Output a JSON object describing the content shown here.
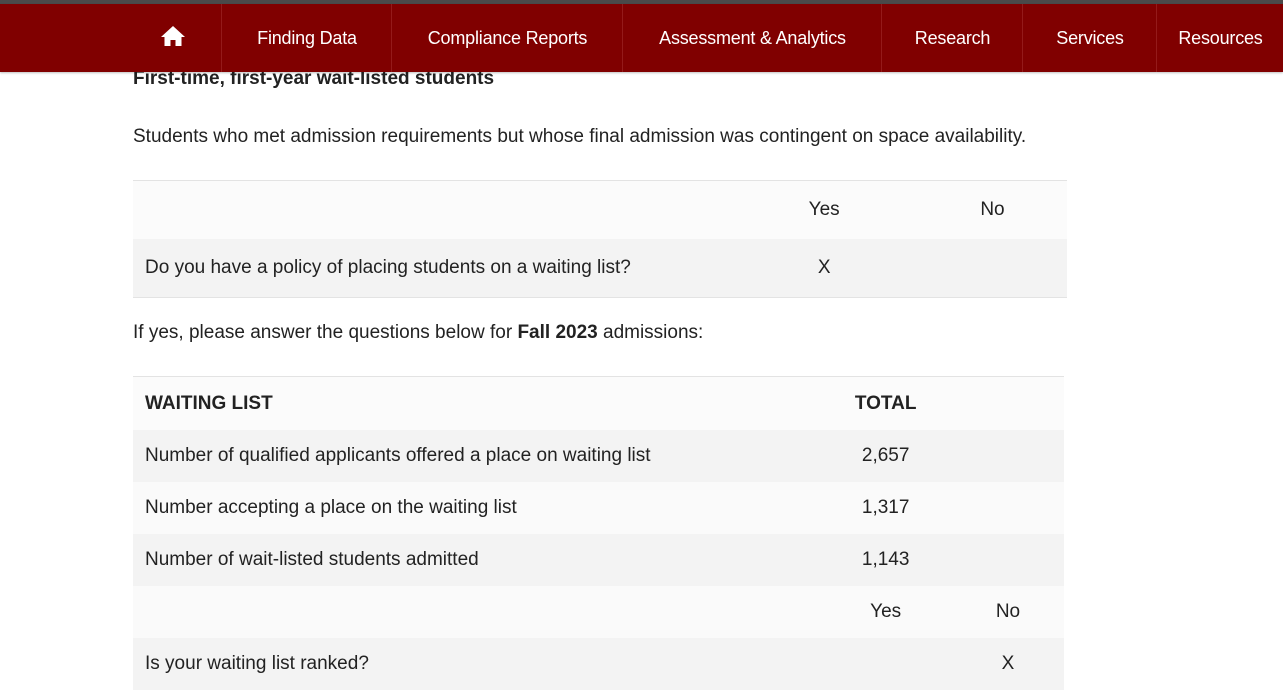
{
  "colors": {
    "nav_bg": "#800000",
    "nav_text": "#ffffff",
    "top_strip": "#4a4a4a",
    "row_shade": "#f3f3f3"
  },
  "nav": {
    "home_icon": "home-icon",
    "items": [
      "Finding Data",
      "Compliance Reports",
      "Assessment & Analytics",
      "Research",
      "Services",
      "Resources"
    ]
  },
  "section": {
    "heading": "First-time, first-year wait-listed students",
    "description": "Students who met admission requirements but whose final admission was contingent on space availability."
  },
  "policy_table": {
    "col_yes": "Yes",
    "col_no": "No",
    "question": "Do you have a policy of placing students on a waiting list?",
    "yes_mark": "X",
    "no_mark": ""
  },
  "intro": {
    "prefix": "If yes, please answer the questions below for ",
    "term": "Fall 2023",
    "suffix": " admissions:"
  },
  "waiting_list": {
    "header_label": "WAITING LIST",
    "header_total": "TOTAL",
    "rows": [
      {
        "label": "Number of qualified applicants offered a place on waiting list",
        "value": "2,657"
      },
      {
        "label": "Number accepting a place on the waiting list",
        "value": "1,317"
      },
      {
        "label": "Number of wait-listed students admitted",
        "value": "1,143"
      }
    ],
    "ranked": {
      "col_yes": "Yes",
      "col_no": "No",
      "question": "Is your waiting list ranked?",
      "yes_mark": "",
      "no_mark": "X"
    }
  }
}
